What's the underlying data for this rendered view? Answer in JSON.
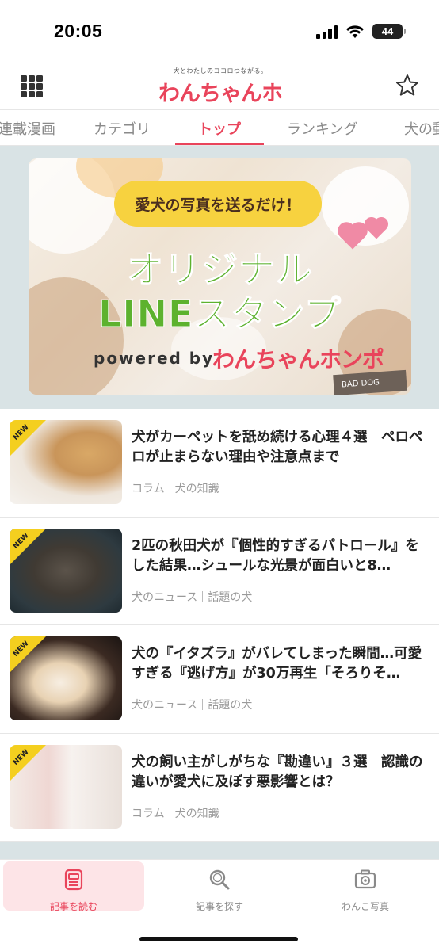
{
  "status_bar": {
    "time": "20:05",
    "battery": "44"
  },
  "header": {
    "logo_tagline": "犬とわたしのココロつながる。",
    "logo_text": "わんちゃんホンポ",
    "menu_icon": "grid-menu-icon",
    "favorite_icon": "star-icon"
  },
  "tabs": [
    {
      "label": "連載漫画"
    },
    {
      "label": "カテゴリ"
    },
    {
      "label": "トップ",
      "active": true
    },
    {
      "label": "ランキング"
    },
    {
      "label": "犬の動"
    }
  ],
  "banner": {
    "pill_text": "愛犬の写真を送るだけ！",
    "title_line1": "オリジナル",
    "title_line2": "LINEスタンプ",
    "powered_by": "powered by",
    "brand": "わんちゃんホンポ",
    "tag": "BAD DOG"
  },
  "articles": [
    {
      "badge": "NEW",
      "title": "犬がカーペットを舐め続ける心理４選　ペロペロが止まらない理由や注意点まで",
      "category": "コラム",
      "subcategory": "犬の知識"
    },
    {
      "badge": "NEW",
      "title": "2匹の秋田犬が『個性的すぎるパトロール』をした結果…シュールな光景が面白いと8…",
      "category": "犬のニュース",
      "subcategory": "話題の犬"
    },
    {
      "badge": "NEW",
      "title": "犬の『イタズラ』がバレてしまった瞬間…可愛すぎる『逃げ方』が30万再生「そろりそ…",
      "category": "犬のニュース",
      "subcategory": "話題の犬"
    },
    {
      "badge": "NEW",
      "title": "犬の飼い主がしがちな『勘違い』３選　認識の違いが愛犬に及ぼす悪影響とは？",
      "category": "コラム",
      "subcategory": "犬の知識"
    }
  ],
  "bottom_nav": [
    {
      "label": "記事を読む",
      "icon": "article-icon",
      "active": true
    },
    {
      "label": "記事を探す",
      "icon": "search-icon"
    },
    {
      "label": "わんこ写真",
      "icon": "camera-icon"
    }
  ],
  "colors": {
    "accent": "#e9445b",
    "banner_bg": "#d9e3e5",
    "badge": "#f4cf1f",
    "stamp_green": "#5db22e"
  }
}
